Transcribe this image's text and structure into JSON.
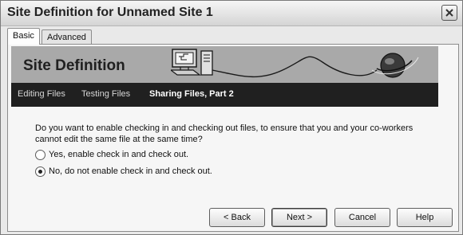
{
  "window": {
    "title": "Site Definition for Unnamed Site 1"
  },
  "tabs": [
    {
      "label": "Basic",
      "selected": true
    },
    {
      "label": "Advanced",
      "selected": false
    }
  ],
  "banner": {
    "title": "Site Definition"
  },
  "steps": [
    {
      "label": "Editing Files",
      "current": false
    },
    {
      "label": "Testing Files",
      "current": false
    },
    {
      "label": "Sharing Files, Part 2",
      "current": true
    }
  ],
  "question": "Do you want to enable checking in and checking out files, to ensure that you and your co-workers cannot edit the same file at the same time?",
  "options": [
    {
      "label": "Yes, enable check in and check out.",
      "selected": false
    },
    {
      "label": "No, do not enable check in and check out.",
      "selected": true
    }
  ],
  "buttons": {
    "back": "< Back",
    "next": "Next >",
    "cancel": "Cancel",
    "help": "Help"
  },
  "icons": {
    "close": "close-icon",
    "banner_art": "computer-cable-globe-illustration"
  }
}
